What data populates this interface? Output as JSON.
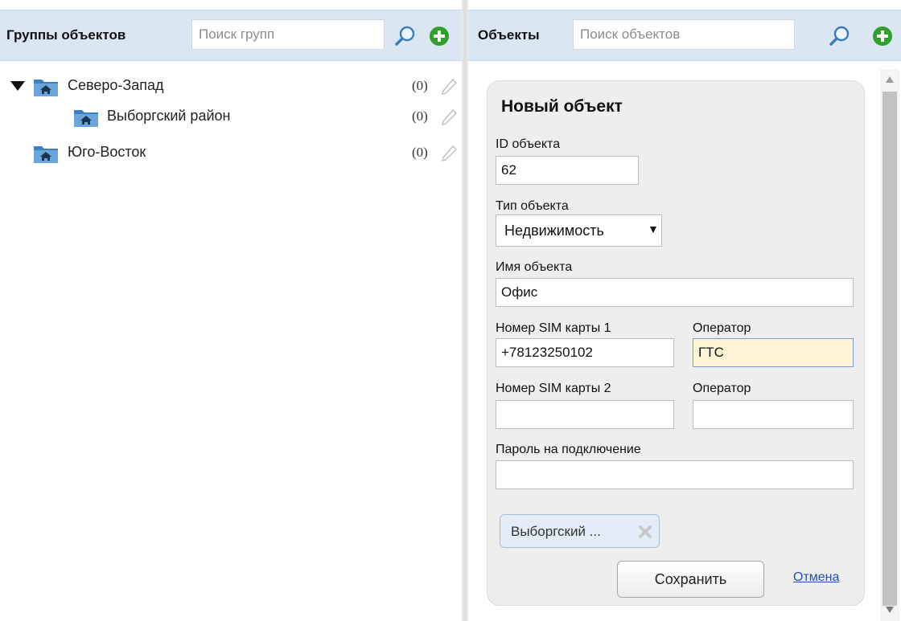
{
  "groups": {
    "title": "Группы объектов",
    "search_placeholder": "Поиск групп",
    "tree": [
      {
        "label": "Северо-Запад",
        "count": "(0)",
        "expanded": true
      },
      {
        "label": "Выборгский район",
        "count": "(0)"
      },
      {
        "label": "Юго-Восток",
        "count": "(0)"
      }
    ]
  },
  "objects": {
    "title": "Объекты",
    "search_placeholder": "Поиск объектов"
  },
  "form": {
    "title": "Новый объект",
    "id_label": "ID объекта",
    "id_value": "62",
    "type_label": "Тип объекта",
    "type_value": "Недвижимость",
    "name_label": "Имя объекта",
    "name_value": "Офис",
    "sim1_label": "Номер SIM карты 1",
    "sim1_value": "+78123250102",
    "operator1_label": "Оператор",
    "operator1_value": "ГТС",
    "sim2_label": "Номер SIM карты 2",
    "sim2_value": "",
    "operator2_label": "Оператор",
    "operator2_value": "",
    "password_label": "Пароль на подключение",
    "password_value": "",
    "group_tag": "Выборгский ...",
    "save_label": "Сохранить",
    "cancel_label": "Отмена"
  },
  "colors": {
    "header_bg": "#dbe6f3",
    "add_green": "#2fa12a",
    "folder_blue": "#3d7fc0",
    "link_blue": "#1f4fb8",
    "focus_bg": "#fdf5d6"
  },
  "icons": [
    "search-icon",
    "add-icon",
    "folder-icon",
    "pencil-icon",
    "expand-caret-icon",
    "remove-icon",
    "dropdown-arrow-icon"
  ]
}
